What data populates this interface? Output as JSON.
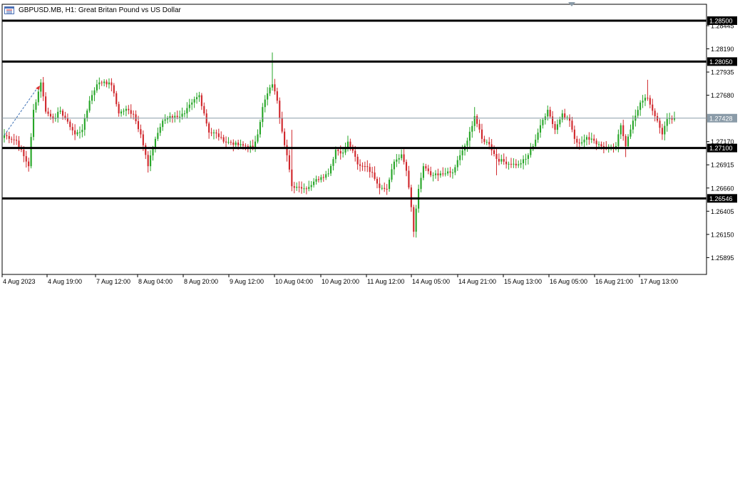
{
  "window": {
    "title": "GBPUSD.MB, H1:  Great Britan Pound vs US Dollar",
    "icon": "chart-window-icon"
  },
  "colors": {
    "bull": "#26a527",
    "bear": "#d0262b",
    "hline": "#000000",
    "current_price_line": "#8a9ba8",
    "current_price_label_bg": "#8a9ba8",
    "axis": "#000000"
  },
  "chart_data": {
    "type": "candlestick",
    "symbol": "GBPUSD.MB",
    "timeframe": "H1",
    "ylim": [
      1.2571,
      1.2868
    ],
    "y_ticks": [
      "1.28445",
      "1.28190",
      "1.27935",
      "1.27680",
      "1.27170",
      "1.26915",
      "1.26660",
      "1.26405",
      "1.26150",
      "1.25895"
    ],
    "x_ticks": [
      "4 Aug 2023",
      "4 Aug 19:00",
      "7 Aug 12:00",
      "8 Aug 04:00",
      "8 Aug 20:00",
      "9 Aug 12:00",
      "10 Aug 04:00",
      "10 Aug 20:00",
      "11 Aug 12:00",
      "14 Aug 05:00",
      "14 Aug 21:00",
      "15 Aug 13:00",
      "16 Aug 05:00",
      "16 Aug 21:00",
      "17 Aug 13:00"
    ],
    "horizontal_lines": [
      {
        "price": 1.285,
        "label": "1.28500"
      },
      {
        "price": 1.2805,
        "label": "1.28050"
      },
      {
        "price": 1.271,
        "label": "1.27100"
      },
      {
        "price": 1.26546,
        "label": "1.26546"
      }
    ],
    "current_price": {
      "price": 1.27428,
      "label": "1.27428"
    },
    "close_anchors": [
      [
        0,
        1.2724
      ],
      [
        5,
        1.2718
      ],
      [
        8,
        1.2701
      ],
      [
        10,
        1.269
      ],
      [
        12,
        1.2752
      ],
      [
        15,
        1.2782
      ],
      [
        17,
        1.275
      ],
      [
        20,
        1.2742
      ],
      [
        23,
        1.2751
      ],
      [
        26,
        1.2739
      ],
      [
        29,
        1.2725
      ],
      [
        32,
        1.273
      ],
      [
        35,
        1.2762
      ],
      [
        38,
        1.278
      ],
      [
        41,
        1.2783
      ],
      [
        44,
        1.2779
      ],
      [
        47,
        1.2748
      ],
      [
        50,
        1.2753
      ],
      [
        53,
        1.2747
      ],
      [
        56,
        1.2725
      ],
      [
        59,
        1.269
      ],
      [
        62,
        1.272
      ],
      [
        65,
        1.274
      ],
      [
        68,
        1.2745
      ],
      [
        71,
        1.2744
      ],
      [
        74,
        1.2748
      ],
      [
        77,
        1.276
      ],
      [
        80,
        1.2768
      ],
      [
        82,
        1.2748
      ],
      [
        84,
        1.2727
      ],
      [
        87,
        1.2726
      ],
      [
        90,
        1.2717
      ],
      [
        93,
        1.2716
      ],
      [
        96,
        1.2713
      ],
      [
        99,
        1.2712
      ],
      [
        102,
        1.2711
      ],
      [
        104,
        1.2725
      ],
      [
        106,
        1.2755
      ],
      [
        108,
        1.277
      ],
      [
        110,
        1.278
      ],
      [
        112,
        1.2762
      ],
      [
        114,
        1.2728
      ],
      [
        116,
        1.2702
      ],
      [
        118,
        1.2668
      ],
      [
        121,
        1.2667
      ],
      [
        124,
        1.2665
      ],
      [
        127,
        1.2673
      ],
      [
        130,
        1.2678
      ],
      [
        133,
        1.2682
      ],
      [
        136,
        1.2708
      ],
      [
        139,
        1.2705
      ],
      [
        141,
        1.2717
      ],
      [
        143,
        1.2707
      ],
      [
        145,
        1.2692
      ],
      [
        148,
        1.269
      ],
      [
        151,
        1.2683
      ],
      [
        154,
        1.2666
      ],
      [
        157,
        1.2665
      ],
      [
        160,
        1.2695
      ],
      [
        163,
        1.2703
      ],
      [
        165,
        1.2685
      ],
      [
        167,
        1.2645
      ],
      [
        168,
        1.2618
      ],
      [
        170,
        1.2665
      ],
      [
        172,
        1.269
      ],
      [
        175,
        1.268
      ],
      [
        178,
        1.268
      ],
      [
        181,
        1.2682
      ],
      [
        184,
        1.2683
      ],
      [
        187,
        1.2702
      ],
      [
        190,
        1.2718
      ],
      [
        193,
        1.2745
      ],
      [
        196,
        1.272
      ],
      [
        199,
        1.2714
      ],
      [
        202,
        1.2698
      ],
      [
        205,
        1.2695
      ],
      [
        208,
        1.2692
      ],
      [
        211,
        1.2692
      ],
      [
        214,
        1.2698
      ],
      [
        217,
        1.2712
      ],
      [
        220,
        1.2735
      ],
      [
        223,
        1.2752
      ],
      [
        226,
        1.273
      ],
      [
        229,
        1.2748
      ],
      [
        232,
        1.274
      ],
      [
        234,
        1.272
      ],
      [
        236,
        1.2715
      ],
      [
        239,
        1.2722
      ],
      [
        242,
        1.2718
      ],
      [
        245,
        1.2712
      ],
      [
        248,
        1.271
      ],
      [
        251,
        1.2712
      ],
      [
        253,
        1.2735
      ],
      [
        255,
        1.2712
      ],
      [
        258,
        1.274
      ],
      [
        261,
        1.276
      ],
      [
        264,
        1.2765
      ],
      [
        267,
        1.2745
      ],
      [
        270,
        1.2725
      ],
      [
        272,
        1.2742
      ],
      [
        275,
        1.2743
      ]
    ]
  }
}
